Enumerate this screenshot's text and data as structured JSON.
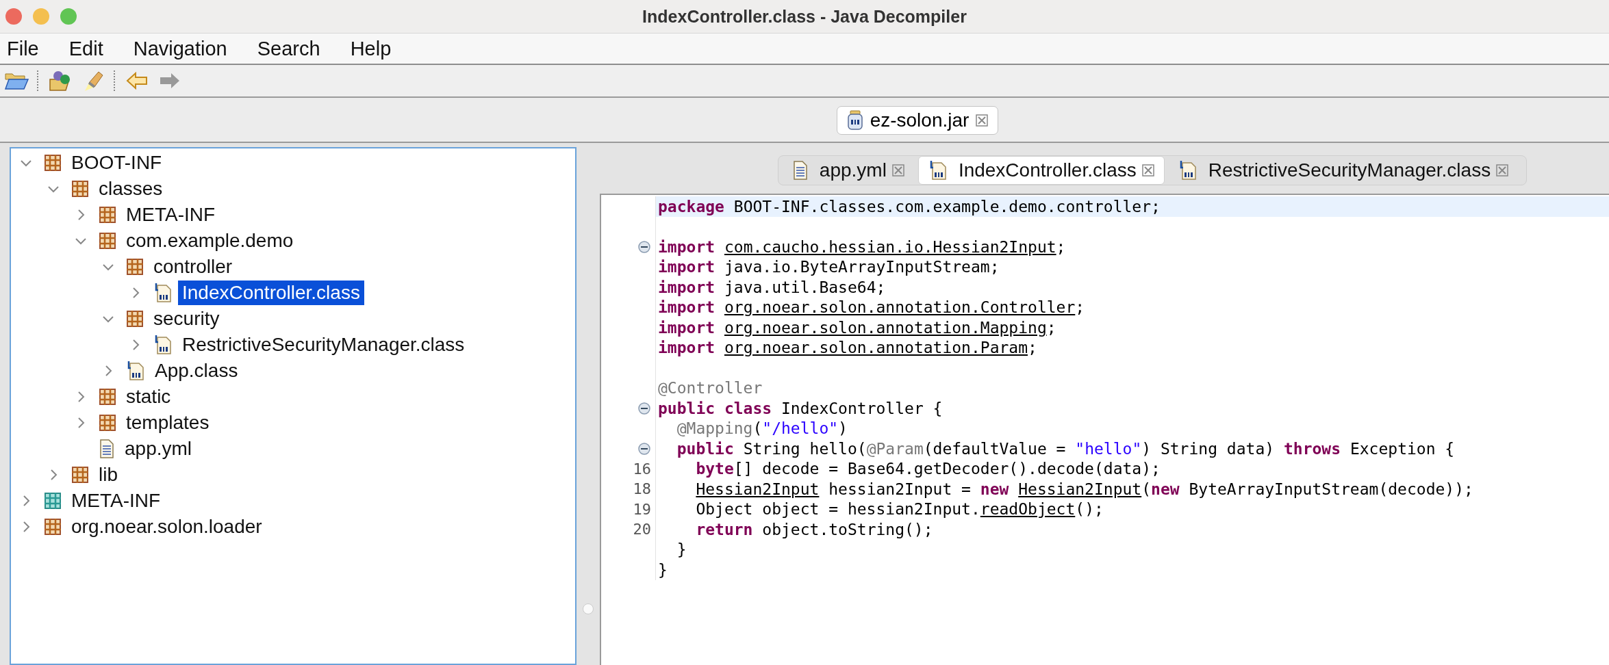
{
  "window": {
    "title": "IndexController.class - Java Decompiler"
  },
  "menu": [
    "File",
    "Edit",
    "Navigation",
    "Search",
    "Help"
  ],
  "toolbar": [
    {
      "kind": "open",
      "disabled": false
    },
    {
      "kind": "separator"
    },
    {
      "kind": "open-type",
      "disabled": false
    },
    {
      "kind": "search",
      "disabled": false
    },
    {
      "kind": "separator"
    },
    {
      "kind": "back",
      "disabled": false
    },
    {
      "kind": "forward",
      "disabled": true
    }
  ],
  "file_tabs": [
    {
      "label": "ez-solon.jar",
      "kind": "jar",
      "selected": true
    }
  ],
  "tree": [
    {
      "label": "BOOT-INF",
      "kind": "package",
      "expanded": true,
      "selected": false,
      "children": [
        {
          "label": "classes",
          "kind": "package",
          "expanded": true,
          "selected": false,
          "children": [
            {
              "label": "META-INF",
              "kind": "package",
              "expanded": false,
              "selected": false
            },
            {
              "label": "com.example.demo",
              "kind": "package",
              "expanded": true,
              "selected": false,
              "children": [
                {
                  "label": "controller",
                  "kind": "package",
                  "expanded": true,
                  "selected": false,
                  "children": [
                    {
                      "label": "IndexController.class",
                      "kind": "class",
                      "expanded": false,
                      "selected": true
                    }
                  ]
                },
                {
                  "label": "security",
                  "kind": "package",
                  "expanded": true,
                  "selected": false,
                  "children": [
                    {
                      "label": "RestrictiveSecurityManager.class",
                      "kind": "class",
                      "expanded": false,
                      "selected": false
                    }
                  ]
                },
                {
                  "label": "App.class",
                  "kind": "class",
                  "expanded": false,
                  "selected": false
                }
              ]
            },
            {
              "label": "static",
              "kind": "package",
              "expanded": false,
              "selected": false
            },
            {
              "label": "templates",
              "kind": "package",
              "expanded": false,
              "selected": false
            },
            {
              "label": "app.yml",
              "kind": "file",
              "selected": false
            }
          ]
        },
        {
          "label": "lib",
          "kind": "package",
          "expanded": false,
          "selected": false
        }
      ]
    },
    {
      "label": "META-INF",
      "kind": "folder",
      "expanded": false,
      "selected": false
    },
    {
      "label": "org.noear.solon.loader",
      "kind": "package",
      "expanded": false,
      "selected": false
    }
  ],
  "editor_tabs": [
    {
      "label": "app.yml",
      "kind": "file",
      "selected": false
    },
    {
      "label": "IndexController.class",
      "kind": "class",
      "selected": true
    },
    {
      "label": "RestrictiveSecurityManager.class",
      "kind": "class",
      "selected": false
    }
  ],
  "code": [
    {
      "kind": "top",
      "highlighted": true,
      "tokens": [
        {
          "kind": "keyword",
          "text": "package "
        },
        {
          "kind": "plain",
          "text": "BOOT-INF.classes.com.example.demo.controller;"
        }
      ]
    },
    {
      "kind": "blank",
      "highlighted": false
    },
    {
      "kind": "top",
      "highlighted": false,
      "fold": true,
      "tokens": [
        {
          "kind": "keyword",
          "text": "import "
        },
        {
          "kind": "link",
          "text": "com.caucho.hessian.io.Hessian2Input"
        },
        {
          "kind": "plain",
          "text": ";"
        }
      ]
    },
    {
      "kind": "top",
      "highlighted": false,
      "tokens": [
        {
          "kind": "keyword",
          "text": "import "
        },
        {
          "kind": "plain",
          "text": "java.io.ByteArrayInputStream;"
        }
      ]
    },
    {
      "kind": "top",
      "highlighted": false,
      "tokens": [
        {
          "kind": "keyword",
          "text": "import "
        },
        {
          "kind": "plain",
          "text": "java.util.Base64;"
        }
      ]
    },
    {
      "kind": "top",
      "highlighted": false,
      "tokens": [
        {
          "kind": "keyword",
          "text": "import "
        },
        {
          "kind": "link",
          "text": "org.noear.solon.annotation.Controller"
        },
        {
          "kind": "plain",
          "text": ";"
        }
      ]
    },
    {
      "kind": "top",
      "highlighted": false,
      "tokens": [
        {
          "kind": "keyword",
          "text": "import "
        },
        {
          "kind": "link",
          "text": "org.noear.solon.annotation.Mapping"
        },
        {
          "kind": "plain",
          "text": ";"
        }
      ]
    },
    {
      "kind": "top",
      "highlighted": false,
      "tokens": [
        {
          "kind": "keyword",
          "text": "import "
        },
        {
          "kind": "link",
          "text": "org.noear.solon.annotation.Param"
        },
        {
          "kind": "plain",
          "text": ";"
        }
      ]
    },
    {
      "kind": "blank",
      "highlighted": false
    },
    {
      "kind": "top",
      "highlighted": false,
      "tokens": [
        {
          "kind": "annotation",
          "text": "@Controller"
        }
      ]
    },
    {
      "kind": "top",
      "highlighted": false,
      "fold": true,
      "tokens": [
        {
          "kind": "keyword",
          "text": "public class "
        },
        {
          "kind": "plain",
          "text": "IndexController {"
        }
      ]
    },
    {
      "kind": "member",
      "highlighted": false,
      "tokens": [
        {
          "kind": "annotation",
          "text": "@Mapping"
        },
        {
          "kind": "plain",
          "text": "("
        },
        {
          "kind": "string",
          "text": "\"/hello\""
        },
        {
          "kind": "plain",
          "text": ")"
        }
      ]
    },
    {
      "kind": "member",
      "highlighted": false,
      "fold": true,
      "tokens": [
        {
          "kind": "keyword",
          "text": "public "
        },
        {
          "kind": "plain",
          "text": "String hello("
        },
        {
          "kind": "annotation",
          "text": "@Param"
        },
        {
          "kind": "plain",
          "text": "(defaultValue = "
        },
        {
          "kind": "string",
          "text": "\"hello\""
        },
        {
          "kind": "plain",
          "text": ") String data) "
        },
        {
          "kind": "keyword",
          "text": "throws "
        },
        {
          "kind": "plain",
          "text": "Exception {"
        }
      ]
    },
    {
      "kind": "body",
      "highlighted": false,
      "number": "16",
      "tokens": [
        {
          "kind": "keyword",
          "text": "byte"
        },
        {
          "kind": "plain",
          "text": "[] decode = Base64.getDecoder().decode(data);"
        }
      ]
    },
    {
      "kind": "body",
      "highlighted": false,
      "number": "18",
      "tokens": [
        {
          "kind": "link",
          "text": "Hessian2Input"
        },
        {
          "kind": "plain",
          "text": " hessian2Input = "
        },
        {
          "kind": "keyword",
          "text": "new "
        },
        {
          "kind": "link",
          "text": "Hessian2Input"
        },
        {
          "kind": "plain",
          "text": "("
        },
        {
          "kind": "keyword",
          "text": "new "
        },
        {
          "kind": "plain",
          "text": "ByteArrayInputStream(decode));"
        }
      ]
    },
    {
      "kind": "body",
      "highlighted": false,
      "number": "19",
      "tokens": [
        {
          "kind": "plain",
          "text": "Object object = hessian2Input."
        },
        {
          "kind": "link",
          "text": "readObject"
        },
        {
          "kind": "plain",
          "text": "();"
        }
      ]
    },
    {
      "kind": "body",
      "highlighted": false,
      "number": "20",
      "tokens": [
        {
          "kind": "keyword",
          "text": "return "
        },
        {
          "kind": "plain",
          "text": "object.toString();"
        }
      ]
    },
    {
      "kind": "member",
      "highlighted": false,
      "tokens": [
        {
          "kind": "plain",
          "text": "}"
        }
      ]
    },
    {
      "kind": "top",
      "highlighted": false,
      "tokens": [
        {
          "kind": "plain",
          "text": "}"
        }
      ]
    }
  ]
}
